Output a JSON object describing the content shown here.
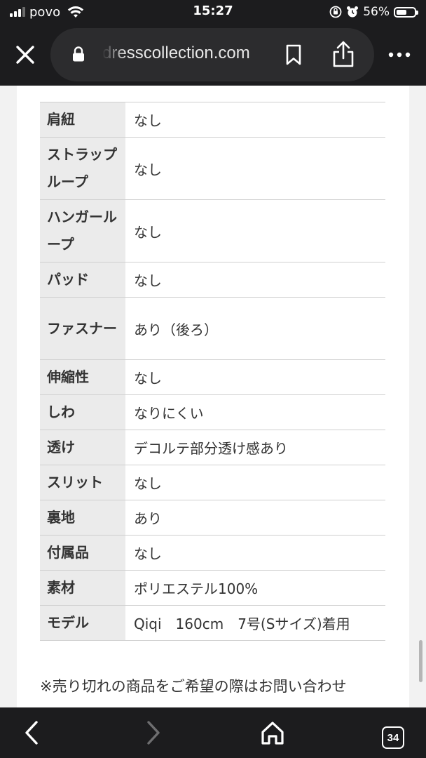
{
  "status_bar": {
    "carrier": "povo",
    "time": "15:27",
    "battery": "56%"
  },
  "toolbar": {
    "url": "dresscollection.com",
    "icons": [
      "close-icon",
      "lock-icon",
      "bookmark-icon",
      "share-icon",
      "more-icon"
    ]
  },
  "spec_table": [
    {
      "key": "肩紐",
      "value": "なし"
    },
    {
      "key": "ストラップループ",
      "value": "なし"
    },
    {
      "key": "ハンガーループ",
      "value": "なし"
    },
    {
      "key": "パッド",
      "value": "なし"
    },
    {
      "key": "ファスナー",
      "value": "あり（後ろ）"
    },
    {
      "key": "伸縮性",
      "value": "なし"
    },
    {
      "key": "しわ",
      "value": "なりにくい"
    },
    {
      "key": "透け",
      "value": "デコルテ部分透け感あり"
    },
    {
      "key": "スリット",
      "value": "なし"
    },
    {
      "key": "裏地",
      "value": "あり"
    },
    {
      "key": "付属品",
      "value": "なし"
    },
    {
      "key": "素材",
      "value": "ポリエステル100%"
    },
    {
      "key": "モデル",
      "value": "Qiqi　160cm　7号(Sサイズ)着用"
    }
  ],
  "note": "※売り切れの商品をご希望の際はお問い合わせ",
  "bottom_nav": {
    "tab_count": "34",
    "icons": [
      "back-icon",
      "forward-icon",
      "home-icon",
      "tabs-icon"
    ]
  }
}
